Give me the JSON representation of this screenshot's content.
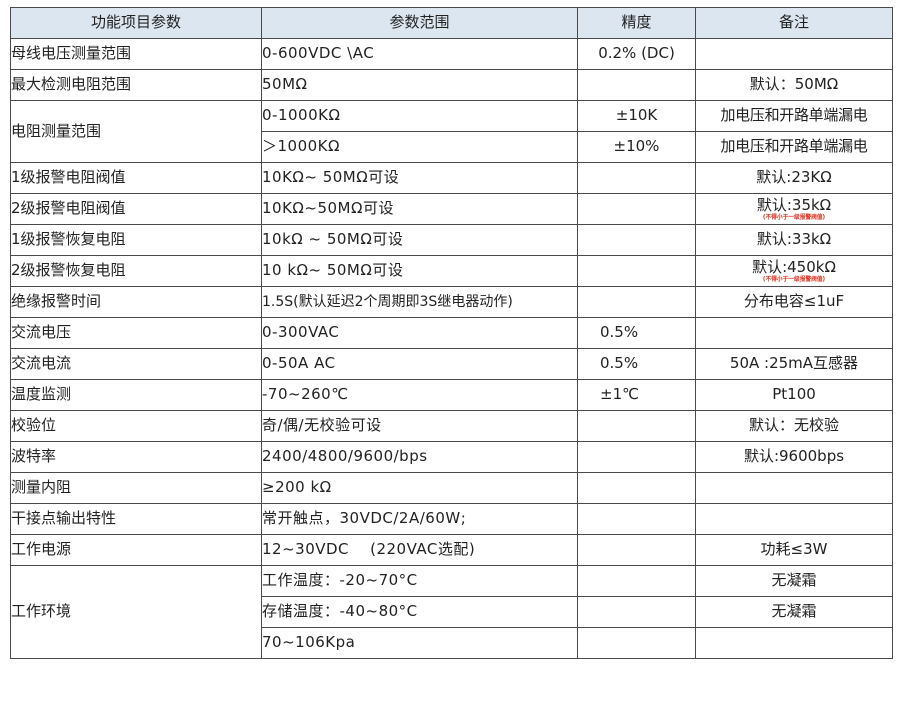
{
  "headers": [
    "功能项目参数",
    "参数范围",
    "精度",
    "备注"
  ],
  "rows": [
    {
      "param": "母线电压测量范围",
      "range": "0-600VDC \\AC",
      "accuracy": "0.2% (DC)",
      "note": ""
    },
    {
      "param": "最大检测电阻范围",
      "range": "50MΩ",
      "accuracy": "",
      "note": "默认：50MΩ"
    },
    {
      "param": "电阻测量范围",
      "range": "0-1000KΩ",
      "accuracy": "±10K",
      "note": "加电压和开路单端漏电"
    },
    {
      "param": "",
      "range": "＞1000KΩ",
      "accuracy": "±10%",
      "note": "加电压和开路单端漏电"
    },
    {
      "param": "1级报警电阻阀值",
      "range": "10KΩ~ 50MΩ可设",
      "accuracy": "",
      "note": "默认:23KΩ"
    },
    {
      "param": "2级报警电阻阀值",
      "range": "10KΩ~50MΩ可设",
      "accuracy": "",
      "note": "默认:35kΩ",
      "note_small": "(不得小于一级报警阀值)"
    },
    {
      "param": "1级报警恢复电阻",
      "range": "10kΩ ~ 50MΩ可设",
      "accuracy": "",
      "note": "默认:33kΩ"
    },
    {
      "param": "2级报警恢复电阻",
      "range": "10 kΩ~ 50MΩ可设",
      "accuracy": "",
      "note": "默认:450kΩ",
      "note_small": "(不得小于一级报警阀值)"
    },
    {
      "param": "绝缘报警时间",
      "range": "1.5S(默认延迟2个周期即3S继电器动作)",
      "accuracy": "",
      "note": "分布电容≤1uF"
    },
    {
      "param": "交流电压",
      "range": "0-300VAC",
      "accuracy": "0.5%",
      "note": ""
    },
    {
      "param": "交流电流",
      "range": "0-50A AC",
      "accuracy": "0.5%",
      "note": "50A :25mA互感器"
    },
    {
      "param": "温度监测",
      "range": "-70~260℃",
      "accuracy": "±1℃",
      "note": "Pt100"
    },
    {
      "param": "校验位",
      "range": "奇/偶/无校验可设",
      "accuracy": "",
      "note": "默认：无校验"
    },
    {
      "param": "波特率",
      "range": "2400/4800/9600/bps",
      "accuracy": "",
      "note": "默认:9600bps"
    },
    {
      "param": "测量内阻",
      "range": "≥200 kΩ",
      "accuracy": "",
      "note": ""
    },
    {
      "param": "干接点输出特性",
      "range": "常开触点，30VDC/2A/60W;",
      "accuracy": "",
      "note": ""
    },
    {
      "param": "工作电源",
      "range": "12~30VDC    (220VAC选配)",
      "accuracy": "",
      "note": "功耗≤3W"
    },
    {
      "param": "工作环境",
      "range": "工作温度：-20~70°C",
      "accuracy": "",
      "note": "无凝霜"
    },
    {
      "param": "",
      "range": "存储温度：-40~80°C",
      "accuracy": "",
      "note": "无凝霜"
    },
    {
      "param": "",
      "range": "70~106Kpa",
      "accuracy": "",
      "note": ""
    }
  ]
}
